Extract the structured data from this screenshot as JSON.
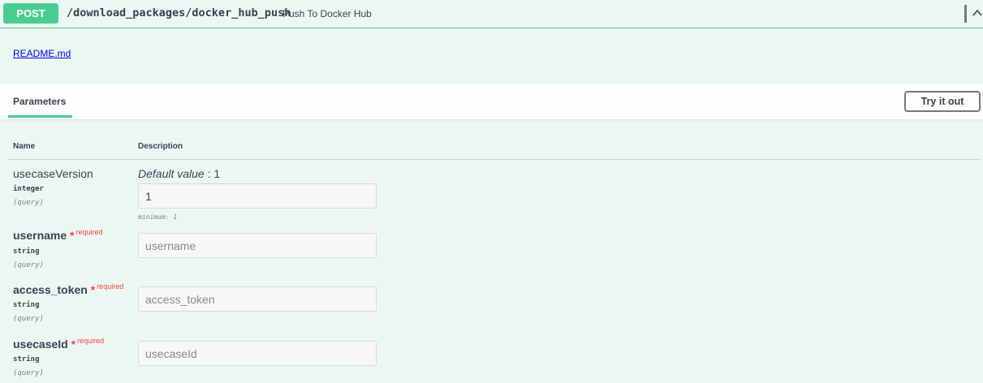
{
  "operation": {
    "method": "POST",
    "path": "/download_packages/docker_hub_push",
    "summary": "Push To Docker Hub",
    "method_color": "#49cc90",
    "expand_icon": "chevron-up-icon"
  },
  "description": {
    "link_text": "README.md"
  },
  "parameters_section": {
    "tab_label": "Parameters",
    "try_button_label": "Try it out"
  },
  "table": {
    "col_name": "Name",
    "col_description": "Description"
  },
  "params": [
    {
      "name": "usecaseVersion",
      "type": "integer",
      "in": "(query)",
      "default_label": "Default value",
      "default_sep": " : ",
      "default_value": "1",
      "value": "1",
      "placeholder": "",
      "constraint": "minimum: 1"
    },
    {
      "name": "username",
      "required_star": "*",
      "required_label": "required",
      "type": "string",
      "in": "(query)",
      "placeholder": "username"
    },
    {
      "name": "access_token",
      "required_star": "*",
      "required_label": "required",
      "type": "string",
      "in": "(query)",
      "placeholder": "access_token"
    },
    {
      "name": "usecaseId",
      "required_star": "*",
      "required_label": "required",
      "type": "string",
      "in": "(query)",
      "placeholder": "usecaseId"
    }
  ]
}
